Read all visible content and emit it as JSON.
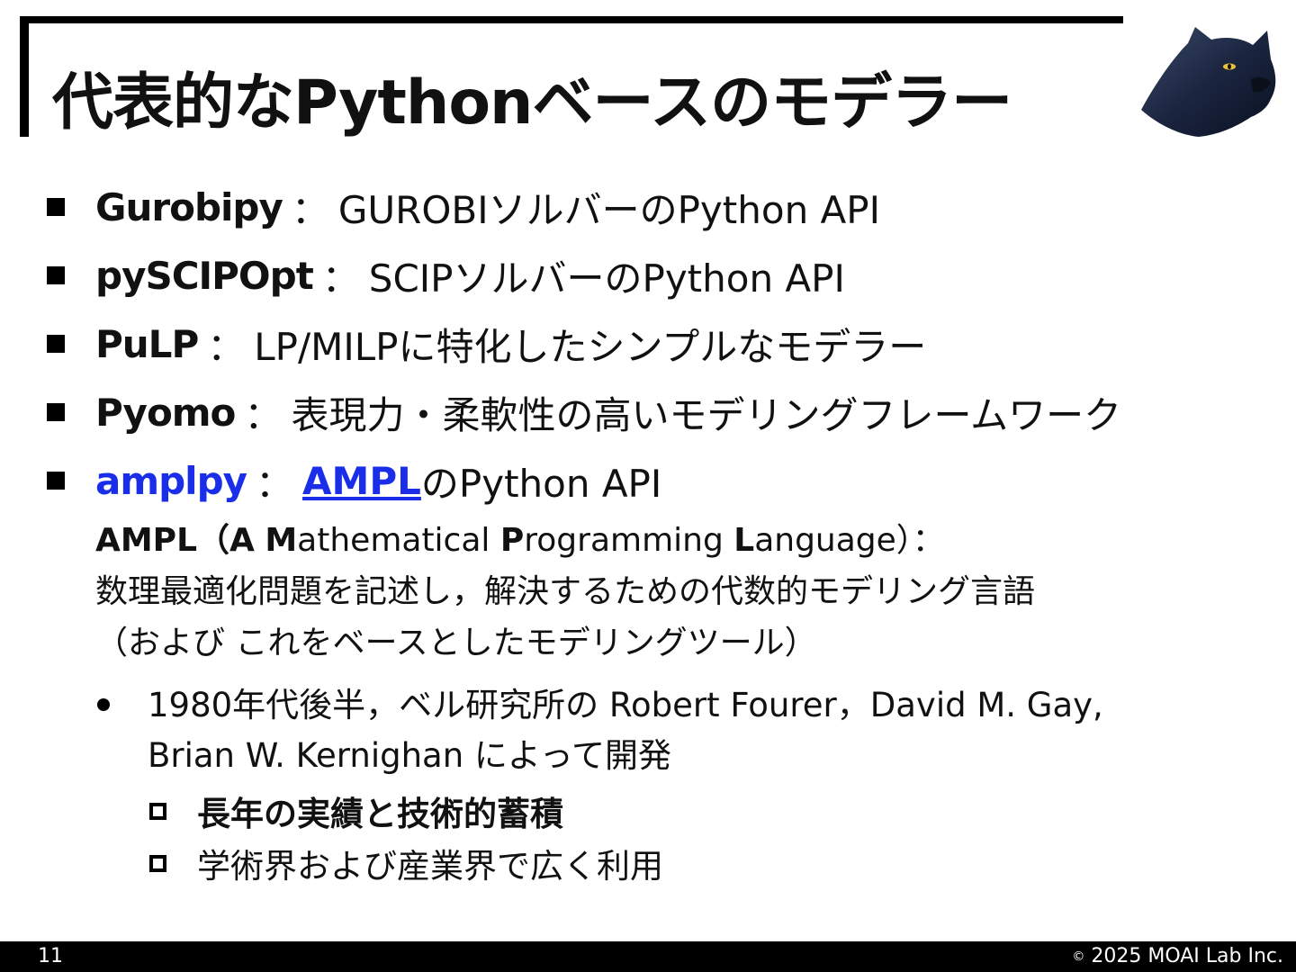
{
  "slide": {
    "title": "代表的なPythonベースのモデラー"
  },
  "bullets": [
    {
      "name": "Gurobipy",
      "sep": "：",
      "desc": "GUROBIソルバーのPython API"
    },
    {
      "name": "pySCIPOpt",
      "sep": "：",
      "desc": "SCIPソルバーのPython API"
    },
    {
      "name": "PuLP",
      "sep": "：",
      "desc": "LP/MILPに特化したシンプルなモデラー"
    },
    {
      "name": "Pyomo",
      "sep": "：",
      "desc": "表現力・柔軟性の高いモデリングフレームワーク"
    },
    {
      "name": "amplpy",
      "sep": "：",
      "link": "AMPL",
      "desc": "のPython API"
    }
  ],
  "ampl_def": {
    "acronym_a": "AMPL（",
    "a1": "A",
    "t1": " ",
    "a2": "M",
    "t2": "athematical ",
    "a3": "P",
    "t3": "rogramming ",
    "a4": "L",
    "t4": "anguage）：",
    "line2": "数理最適化問題を記述し，解決するための代数的モデリング言語",
    "line3": "（および これをベースとしたモデリングツール）"
  },
  "history": {
    "line1": "1980年代後半，ベル研究所の Robert Fourer，David M. Gay,",
    "line2": "Brian W. Kernighan によって開発"
  },
  "sub_bullets": [
    {
      "text": "長年の実績と技術的蓄積",
      "bold": true
    },
    {
      "text": "学術界および産業界で広く利用",
      "bold": false
    }
  ],
  "footer": {
    "page_number": "11",
    "copyright_symbol": "©",
    "copyright": "2025 MOAI Lab Inc."
  },
  "colors": {
    "accent_blue": "#1a2eea",
    "frame": "#000000",
    "footer_bg": "#000000"
  },
  "icons": {
    "logo": "panther-head-logo"
  }
}
